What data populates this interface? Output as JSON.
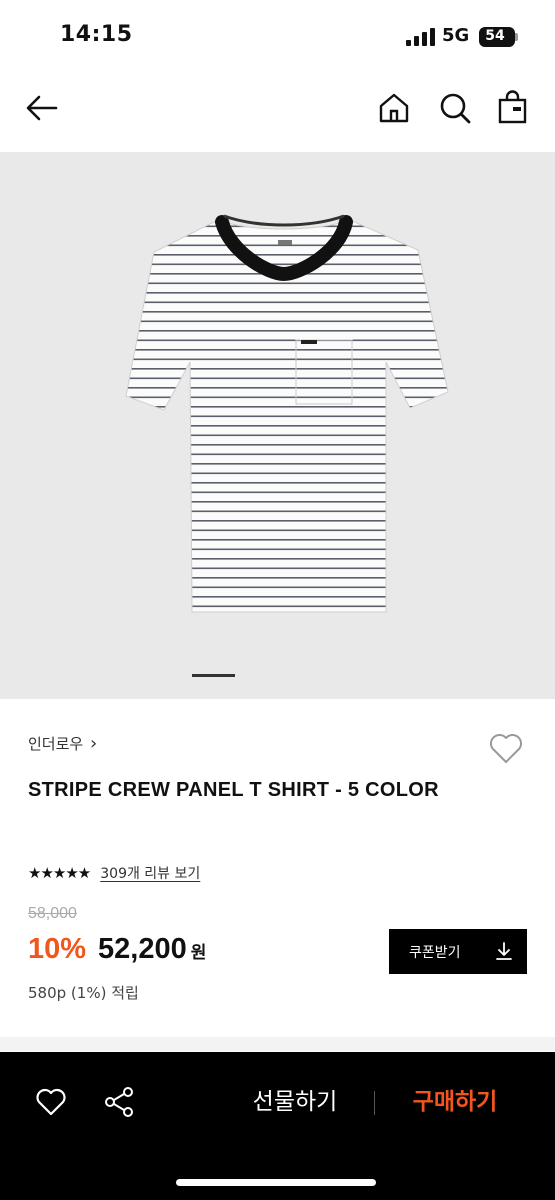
{
  "status_bar": {
    "time": "14:15",
    "network": "5G",
    "battery": "54"
  },
  "top_nav": {
    "icons": [
      "back-arrow-icon",
      "home-icon",
      "search-icon",
      "shopping-bag-icon"
    ]
  },
  "product": {
    "brand": "인더로우",
    "brand_chevron": "›",
    "title": "STRIPE CREW PANEL T SHIRT - 5 COLOR",
    "stars": "★★★★★",
    "rating_out_of_5": 5,
    "review_link": "309개 리뷰 보기",
    "original_price": "58,000",
    "discount": "10%",
    "sale_price": "52,200",
    "currency": "원",
    "points": "580p (1%) 적립",
    "coupon_button": "쿠폰받기",
    "image_pager": {
      "current": 1
    }
  },
  "bottom_bar": {
    "gift_label": "선물하기",
    "buy_label": "구매하기",
    "icons": [
      "heart-icon",
      "share-icon"
    ]
  },
  "colors": {
    "accent": "#f0561d",
    "bottom_bar_bg": "#000000",
    "hero_bg": "#e9e9e9"
  }
}
